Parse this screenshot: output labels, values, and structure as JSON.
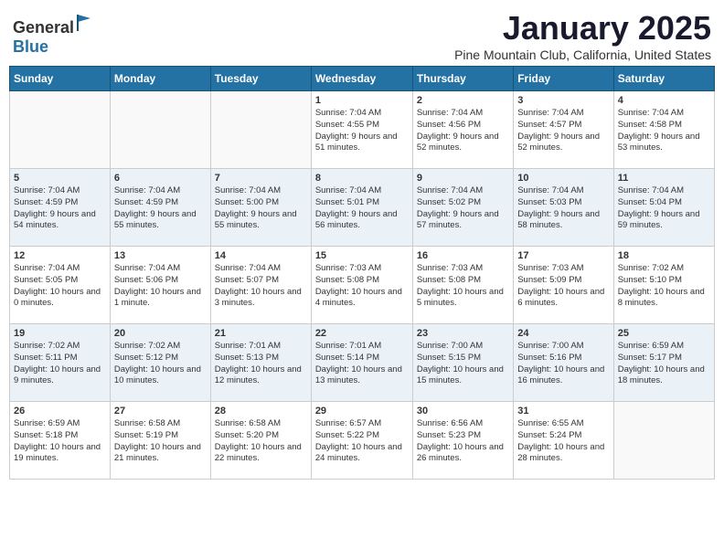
{
  "header": {
    "logo_general": "General",
    "logo_blue": "Blue",
    "month_title": "January 2025",
    "location": "Pine Mountain Club, California, United States"
  },
  "weekdays": [
    "Sunday",
    "Monday",
    "Tuesday",
    "Wednesday",
    "Thursday",
    "Friday",
    "Saturday"
  ],
  "weeks": [
    [
      {
        "day": "",
        "sunrise": "",
        "sunset": "",
        "daylight": ""
      },
      {
        "day": "",
        "sunrise": "",
        "sunset": "",
        "daylight": ""
      },
      {
        "day": "",
        "sunrise": "",
        "sunset": "",
        "daylight": ""
      },
      {
        "day": "1",
        "sunrise": "Sunrise: 7:04 AM",
        "sunset": "Sunset: 4:55 PM",
        "daylight": "Daylight: 9 hours and 51 minutes."
      },
      {
        "day": "2",
        "sunrise": "Sunrise: 7:04 AM",
        "sunset": "Sunset: 4:56 PM",
        "daylight": "Daylight: 9 hours and 52 minutes."
      },
      {
        "day": "3",
        "sunrise": "Sunrise: 7:04 AM",
        "sunset": "Sunset: 4:57 PM",
        "daylight": "Daylight: 9 hours and 52 minutes."
      },
      {
        "day": "4",
        "sunrise": "Sunrise: 7:04 AM",
        "sunset": "Sunset: 4:58 PM",
        "daylight": "Daylight: 9 hours and 53 minutes."
      }
    ],
    [
      {
        "day": "5",
        "sunrise": "Sunrise: 7:04 AM",
        "sunset": "Sunset: 4:59 PM",
        "daylight": "Daylight: 9 hours and 54 minutes."
      },
      {
        "day": "6",
        "sunrise": "Sunrise: 7:04 AM",
        "sunset": "Sunset: 4:59 PM",
        "daylight": "Daylight: 9 hours and 55 minutes."
      },
      {
        "day": "7",
        "sunrise": "Sunrise: 7:04 AM",
        "sunset": "Sunset: 5:00 PM",
        "daylight": "Daylight: 9 hours and 55 minutes."
      },
      {
        "day": "8",
        "sunrise": "Sunrise: 7:04 AM",
        "sunset": "Sunset: 5:01 PM",
        "daylight": "Daylight: 9 hours and 56 minutes."
      },
      {
        "day": "9",
        "sunrise": "Sunrise: 7:04 AM",
        "sunset": "Sunset: 5:02 PM",
        "daylight": "Daylight: 9 hours and 57 minutes."
      },
      {
        "day": "10",
        "sunrise": "Sunrise: 7:04 AM",
        "sunset": "Sunset: 5:03 PM",
        "daylight": "Daylight: 9 hours and 58 minutes."
      },
      {
        "day": "11",
        "sunrise": "Sunrise: 7:04 AM",
        "sunset": "Sunset: 5:04 PM",
        "daylight": "Daylight: 9 hours and 59 minutes."
      }
    ],
    [
      {
        "day": "12",
        "sunrise": "Sunrise: 7:04 AM",
        "sunset": "Sunset: 5:05 PM",
        "daylight": "Daylight: 10 hours and 0 minutes."
      },
      {
        "day": "13",
        "sunrise": "Sunrise: 7:04 AM",
        "sunset": "Sunset: 5:06 PM",
        "daylight": "Daylight: 10 hours and 1 minute."
      },
      {
        "day": "14",
        "sunrise": "Sunrise: 7:04 AM",
        "sunset": "Sunset: 5:07 PM",
        "daylight": "Daylight: 10 hours and 3 minutes."
      },
      {
        "day": "15",
        "sunrise": "Sunrise: 7:03 AM",
        "sunset": "Sunset: 5:08 PM",
        "daylight": "Daylight: 10 hours and 4 minutes."
      },
      {
        "day": "16",
        "sunrise": "Sunrise: 7:03 AM",
        "sunset": "Sunset: 5:08 PM",
        "daylight": "Daylight: 10 hours and 5 minutes."
      },
      {
        "day": "17",
        "sunrise": "Sunrise: 7:03 AM",
        "sunset": "Sunset: 5:09 PM",
        "daylight": "Daylight: 10 hours and 6 minutes."
      },
      {
        "day": "18",
        "sunrise": "Sunrise: 7:02 AM",
        "sunset": "Sunset: 5:10 PM",
        "daylight": "Daylight: 10 hours and 8 minutes."
      }
    ],
    [
      {
        "day": "19",
        "sunrise": "Sunrise: 7:02 AM",
        "sunset": "Sunset: 5:11 PM",
        "daylight": "Daylight: 10 hours and 9 minutes."
      },
      {
        "day": "20",
        "sunrise": "Sunrise: 7:02 AM",
        "sunset": "Sunset: 5:12 PM",
        "daylight": "Daylight: 10 hours and 10 minutes."
      },
      {
        "day": "21",
        "sunrise": "Sunrise: 7:01 AM",
        "sunset": "Sunset: 5:13 PM",
        "daylight": "Daylight: 10 hours and 12 minutes."
      },
      {
        "day": "22",
        "sunrise": "Sunrise: 7:01 AM",
        "sunset": "Sunset: 5:14 PM",
        "daylight": "Daylight: 10 hours and 13 minutes."
      },
      {
        "day": "23",
        "sunrise": "Sunrise: 7:00 AM",
        "sunset": "Sunset: 5:15 PM",
        "daylight": "Daylight: 10 hours and 15 minutes."
      },
      {
        "day": "24",
        "sunrise": "Sunrise: 7:00 AM",
        "sunset": "Sunset: 5:16 PM",
        "daylight": "Daylight: 10 hours and 16 minutes."
      },
      {
        "day": "25",
        "sunrise": "Sunrise: 6:59 AM",
        "sunset": "Sunset: 5:17 PM",
        "daylight": "Daylight: 10 hours and 18 minutes."
      }
    ],
    [
      {
        "day": "26",
        "sunrise": "Sunrise: 6:59 AM",
        "sunset": "Sunset: 5:18 PM",
        "daylight": "Daylight: 10 hours and 19 minutes."
      },
      {
        "day": "27",
        "sunrise": "Sunrise: 6:58 AM",
        "sunset": "Sunset: 5:19 PM",
        "daylight": "Daylight: 10 hours and 21 minutes."
      },
      {
        "day": "28",
        "sunrise": "Sunrise: 6:58 AM",
        "sunset": "Sunset: 5:20 PM",
        "daylight": "Daylight: 10 hours and 22 minutes."
      },
      {
        "day": "29",
        "sunrise": "Sunrise: 6:57 AM",
        "sunset": "Sunset: 5:22 PM",
        "daylight": "Daylight: 10 hours and 24 minutes."
      },
      {
        "day": "30",
        "sunrise": "Sunrise: 6:56 AM",
        "sunset": "Sunset: 5:23 PM",
        "daylight": "Daylight: 10 hours and 26 minutes."
      },
      {
        "day": "31",
        "sunrise": "Sunrise: 6:55 AM",
        "sunset": "Sunset: 5:24 PM",
        "daylight": "Daylight: 10 hours and 28 minutes."
      },
      {
        "day": "",
        "sunrise": "",
        "sunset": "",
        "daylight": ""
      }
    ]
  ]
}
